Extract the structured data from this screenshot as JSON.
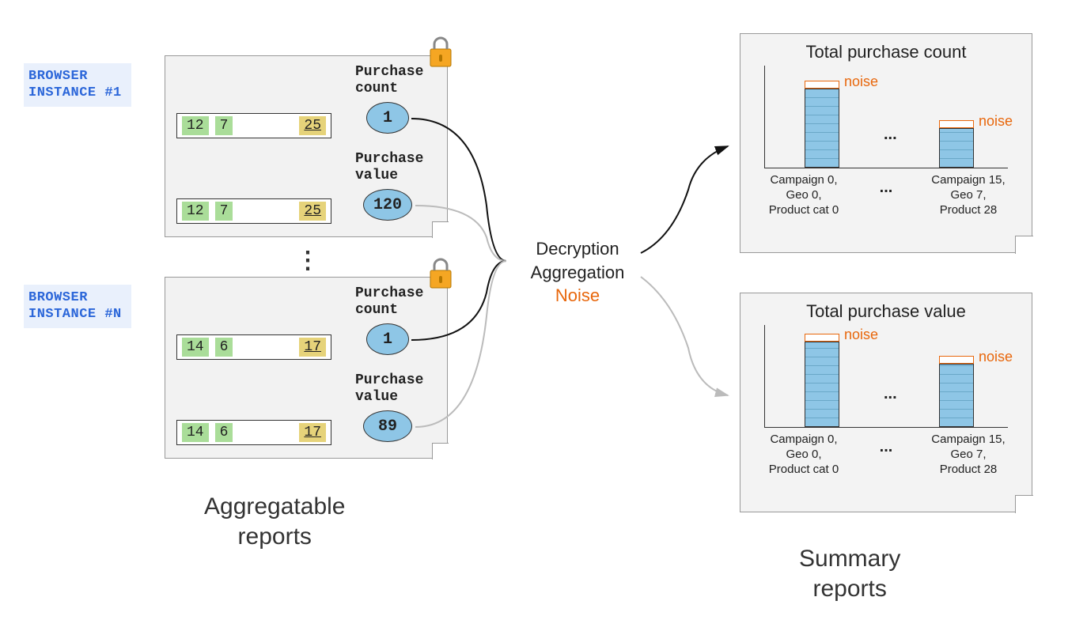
{
  "browsers": {
    "b1": "BROWSER\nINSTANCE #1",
    "bn": "BROWSER\nINSTANCE #N"
  },
  "reports": {
    "r1": {
      "row1": {
        "a": "12",
        "b": "7",
        "c": "25"
      },
      "row2": {
        "a": "12",
        "b": "7",
        "c": "25"
      },
      "count_label": "Purchase\ncount",
      "count_val": "1",
      "value_label": "Purchase\nvalue",
      "value_val": "120"
    },
    "rn": {
      "row1": {
        "a": "14",
        "b": "6",
        "c": "17"
      },
      "row2": {
        "a": "14",
        "b": "6",
        "c": "17"
      },
      "count_label": "Purchase\ncount",
      "count_val": "1",
      "value_label": "Purchase\nvalue",
      "value_val": "89"
    }
  },
  "center": {
    "l1": "Decryption",
    "l2": "Aggregation",
    "l3": "Noise"
  },
  "left_label": "Aggregatable\nreports",
  "right_label": "Summary\nreports",
  "summary": {
    "count": {
      "title": "Total purchase count",
      "noise": "noise",
      "xl1": "Campaign 0,\nGeo 0,\nProduct cat 0",
      "xl2": "Campaign 15,\nGeo 7,\nProduct 28",
      "dots": "..."
    },
    "value": {
      "title": "Total purchase value",
      "noise": "noise",
      "xl1": "Campaign 0,\nGeo 0,\nProduct cat 0",
      "xl2": "Campaign 15,\nGeo 7,\nProduct 28",
      "dots": "..."
    }
  },
  "ellipsis": "⋮",
  "chart_dots": "...",
  "chart_data": [
    {
      "type": "bar",
      "title": "Total purchase count",
      "categories": [
        "Campaign 0, Geo 0, Product cat 0",
        "...",
        "Campaign 15, Geo 7, Product 28"
      ],
      "values": [
        90,
        null,
        45
      ],
      "noise_overlay": true,
      "xlabel": "",
      "ylabel": "",
      "ylim": [
        0,
        100
      ]
    },
    {
      "type": "bar",
      "title": "Total purchase value",
      "categories": [
        "Campaign 0, Geo 0, Product cat 0",
        "...",
        "Campaign 15, Geo 7, Product 28"
      ],
      "values": [
        95,
        null,
        70
      ],
      "noise_overlay": true,
      "xlabel": "",
      "ylabel": "",
      "ylim": [
        0,
        100
      ]
    }
  ]
}
